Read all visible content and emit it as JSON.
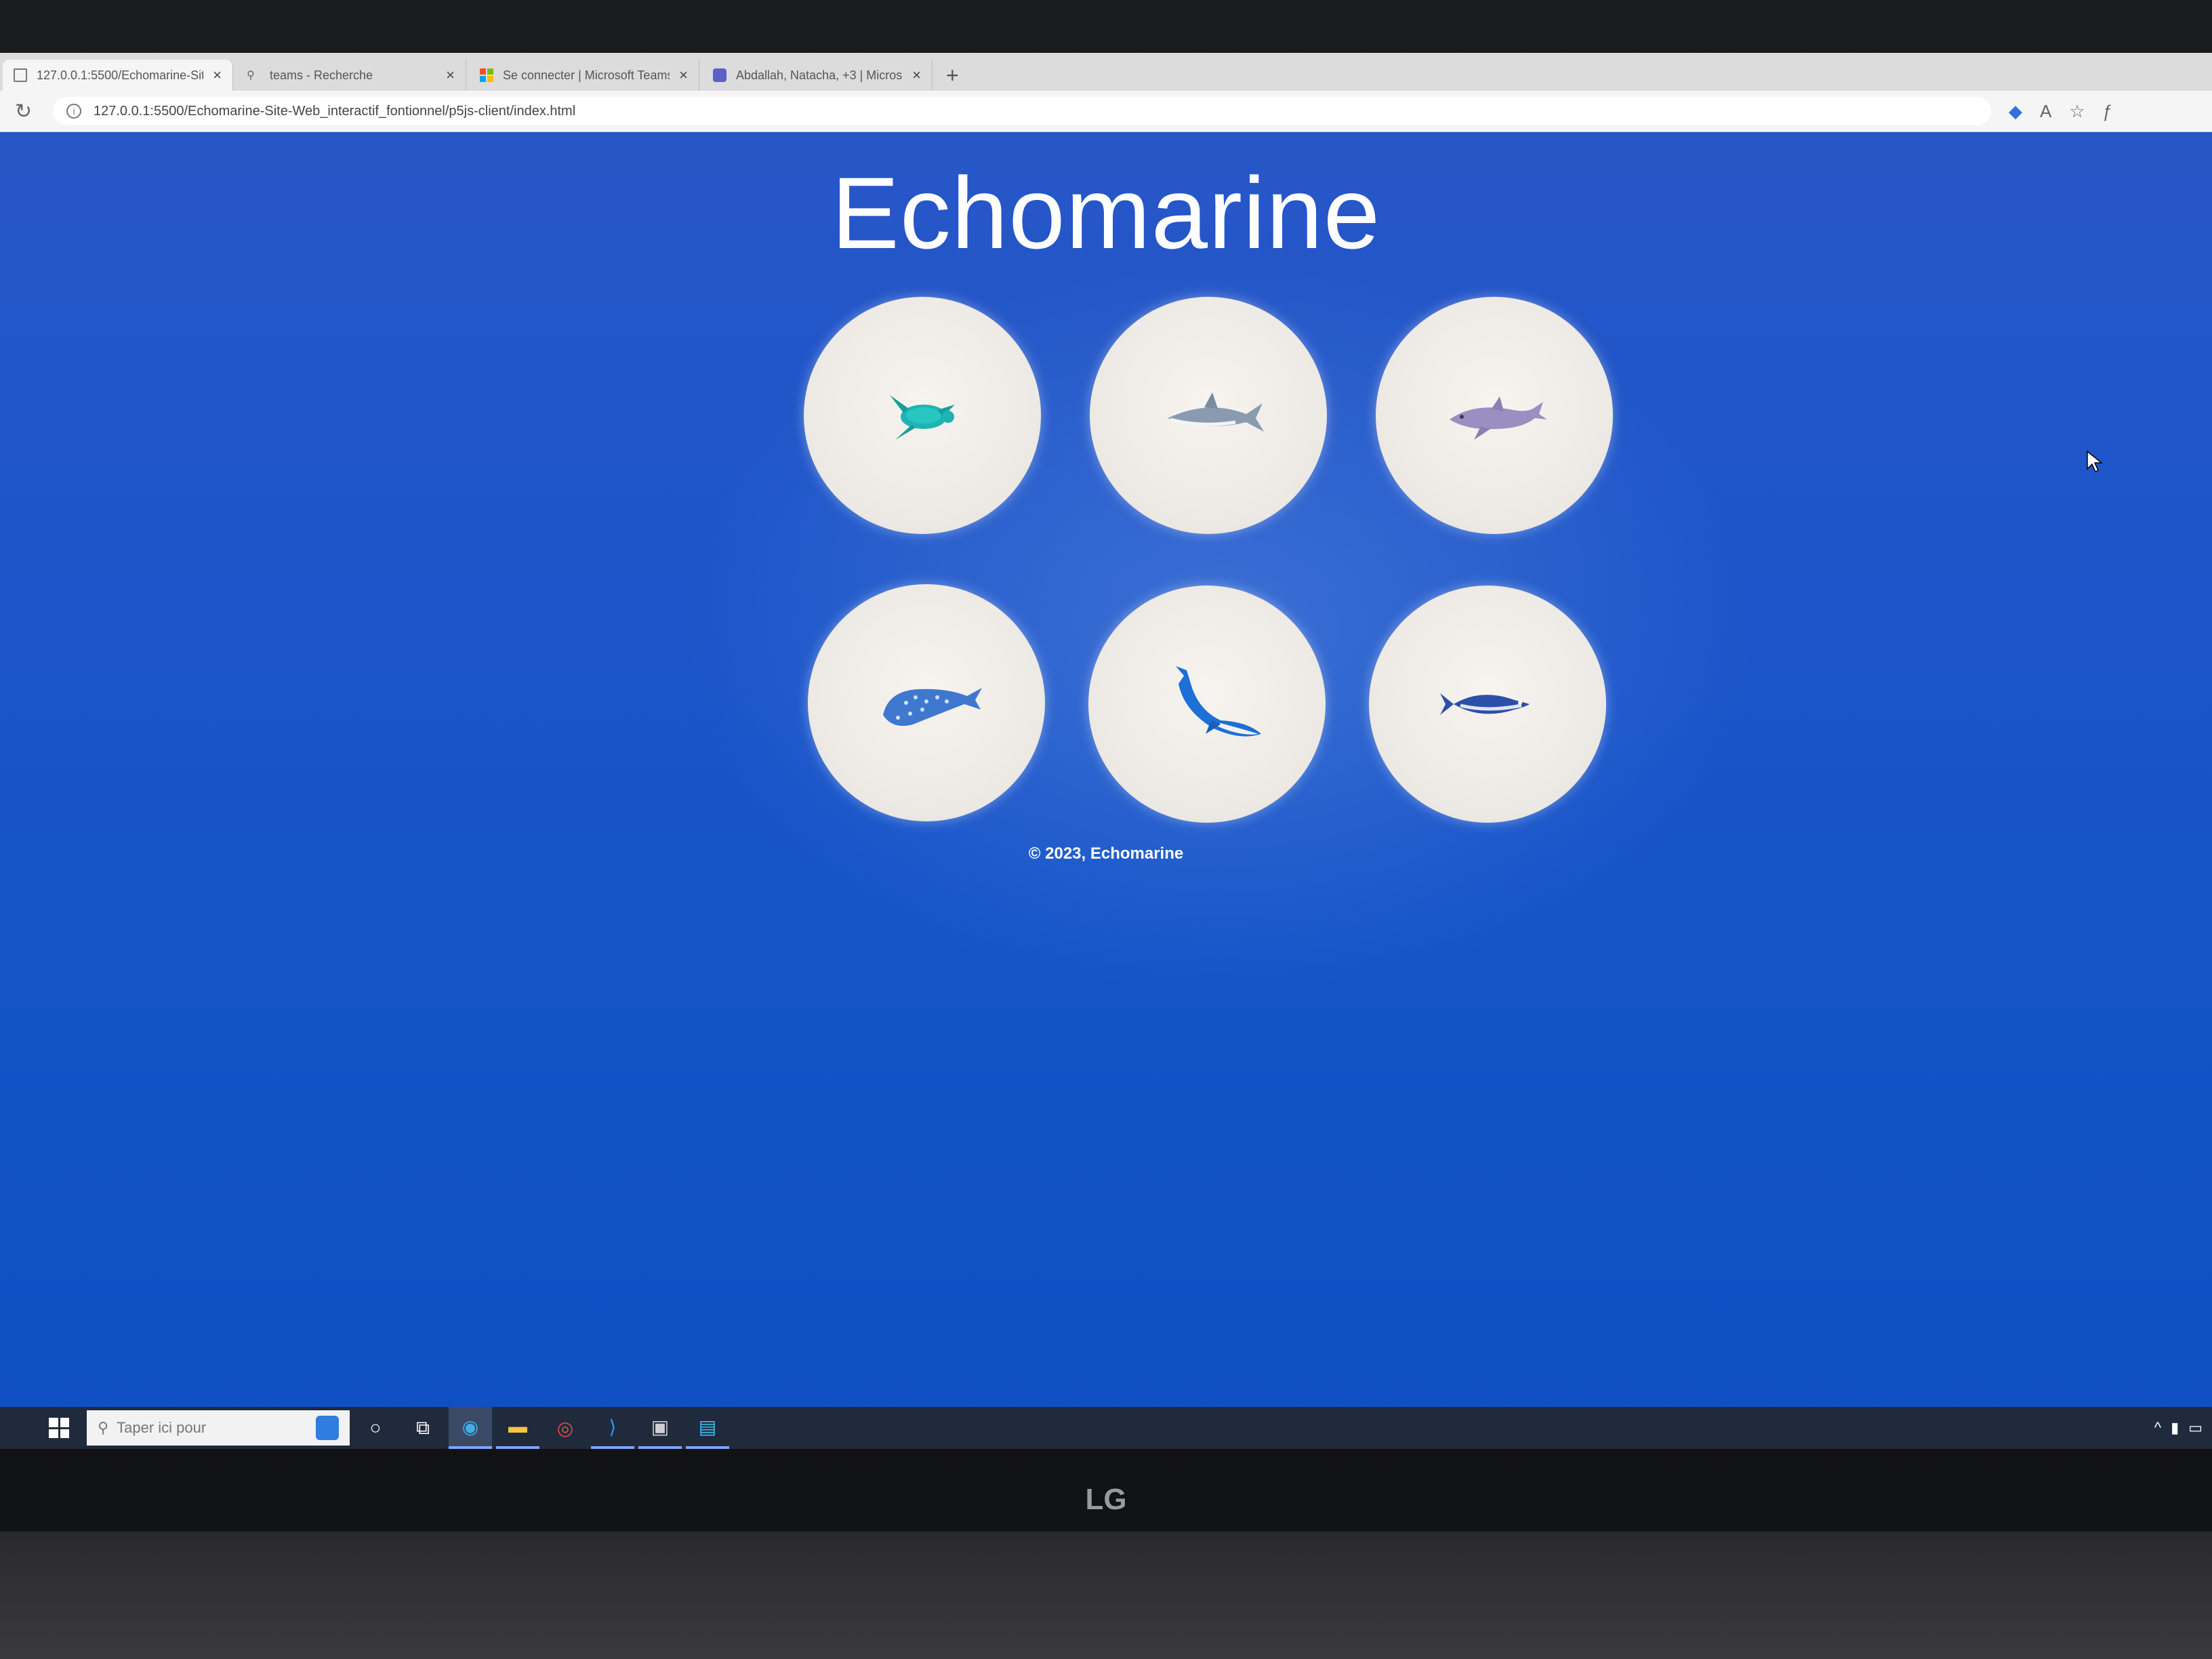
{
  "browser": {
    "tabs": [
      {
        "label": "127.0.0.1:5500/Echomarine-Site-",
        "favicon": "page-icon",
        "active": true
      },
      {
        "label": "teams - Recherche",
        "favicon": "search-icon",
        "active": false
      },
      {
        "label": "Se connecter | Microsoft Teams",
        "favicon": "microsoft-icon",
        "active": false
      },
      {
        "label": "Abdallah, Natacha, +3 | Microsof",
        "favicon": "teams-icon",
        "active": false
      }
    ],
    "new_tab": "+",
    "url": "127.0.0.1:5500/Echomarine-Site-Web_interactif_fontionnel/p5js-client/index.html"
  },
  "page": {
    "title": "Echomarine",
    "animals": [
      {
        "name": "turtle",
        "icon": "sea-turtle-icon",
        "color": "#1fb3b3"
      },
      {
        "name": "shark",
        "icon": "shark-icon",
        "color": "#8a9bb0"
      },
      {
        "name": "dolphin",
        "icon": "dolphin-icon",
        "color": "#9a8fc0"
      },
      {
        "name": "whale-shark",
        "icon": "whale-shark-icon",
        "color": "#3f78cf"
      },
      {
        "name": "blue-whale",
        "icon": "blue-whale-icon",
        "color": "#1e6fd6"
      },
      {
        "name": "tuna",
        "icon": "tuna-icon",
        "color": "#2c4fa8"
      }
    ],
    "footer": "© 2023, Echomarine"
  },
  "taskbar": {
    "search_placeholder": "Taper ici pour",
    "apps": [
      "cortana-icon",
      "task-view-icon",
      "edge-icon",
      "file-explorer-icon",
      "chrome-icon",
      "vscode-icon",
      "app-icon",
      "paint-icon"
    ]
  },
  "monitor": {
    "brand": "LG"
  },
  "colors": {
    "page_background": "#1f56c9",
    "circle": "#f1ede8"
  }
}
